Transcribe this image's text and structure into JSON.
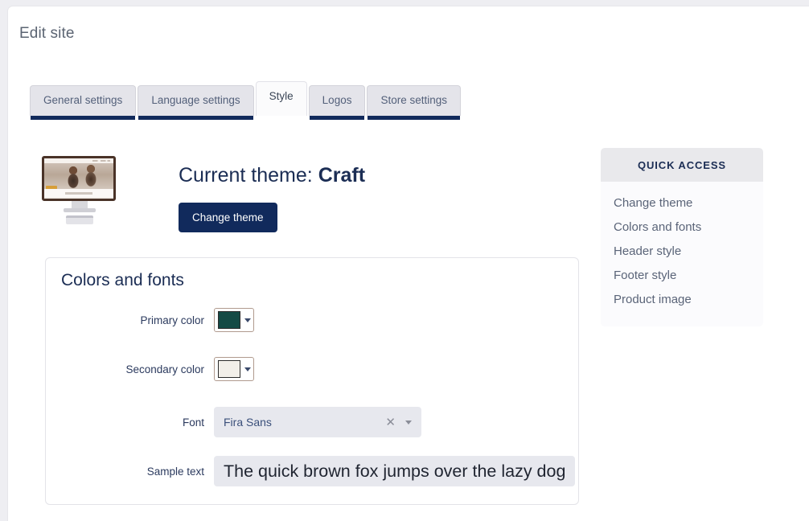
{
  "page": {
    "title": "Edit site",
    "background_color": "#eeeef2",
    "card_color": "#ffffff",
    "accent_navy": "#112a5c"
  },
  "tabs": [
    {
      "label": "General settings",
      "active": false
    },
    {
      "label": "Language settings",
      "active": false
    },
    {
      "label": "Style",
      "active": true
    },
    {
      "label": "Logos",
      "active": false
    },
    {
      "label": "Store settings",
      "active": false
    }
  ],
  "theme": {
    "heading_prefix": "Current theme: ",
    "name": "Craft",
    "change_button": "Change theme",
    "thumbnail_icon": "desktop-monitor-preview-icon"
  },
  "colors_and_fonts": {
    "title": "Colors and fonts",
    "fields": {
      "primary_color": {
        "label": "Primary color",
        "value": "#144a45",
        "control_icon": "color-swatch-dropdown-icon"
      },
      "secondary_color": {
        "label": "Secondary color",
        "value": "#f2efe9",
        "control_icon": "color-swatch-dropdown-icon"
      },
      "font": {
        "label": "Font",
        "value": "Fira Sans",
        "placeholder": "Select font",
        "clear_icon": "close-x-icon",
        "dropdown_icon": "chevron-down-icon"
      },
      "sample_text": {
        "label": "Sample text",
        "value": "The quick brown fox jumps over the lazy dog",
        "placeholder": "Sample text"
      }
    }
  },
  "quick_access": {
    "header": "QUICK ACCESS",
    "links": [
      {
        "label": "Change theme"
      },
      {
        "label": "Colors and fonts"
      },
      {
        "label": "Header style"
      },
      {
        "label": "Footer style"
      },
      {
        "label": "Product image"
      }
    ]
  }
}
